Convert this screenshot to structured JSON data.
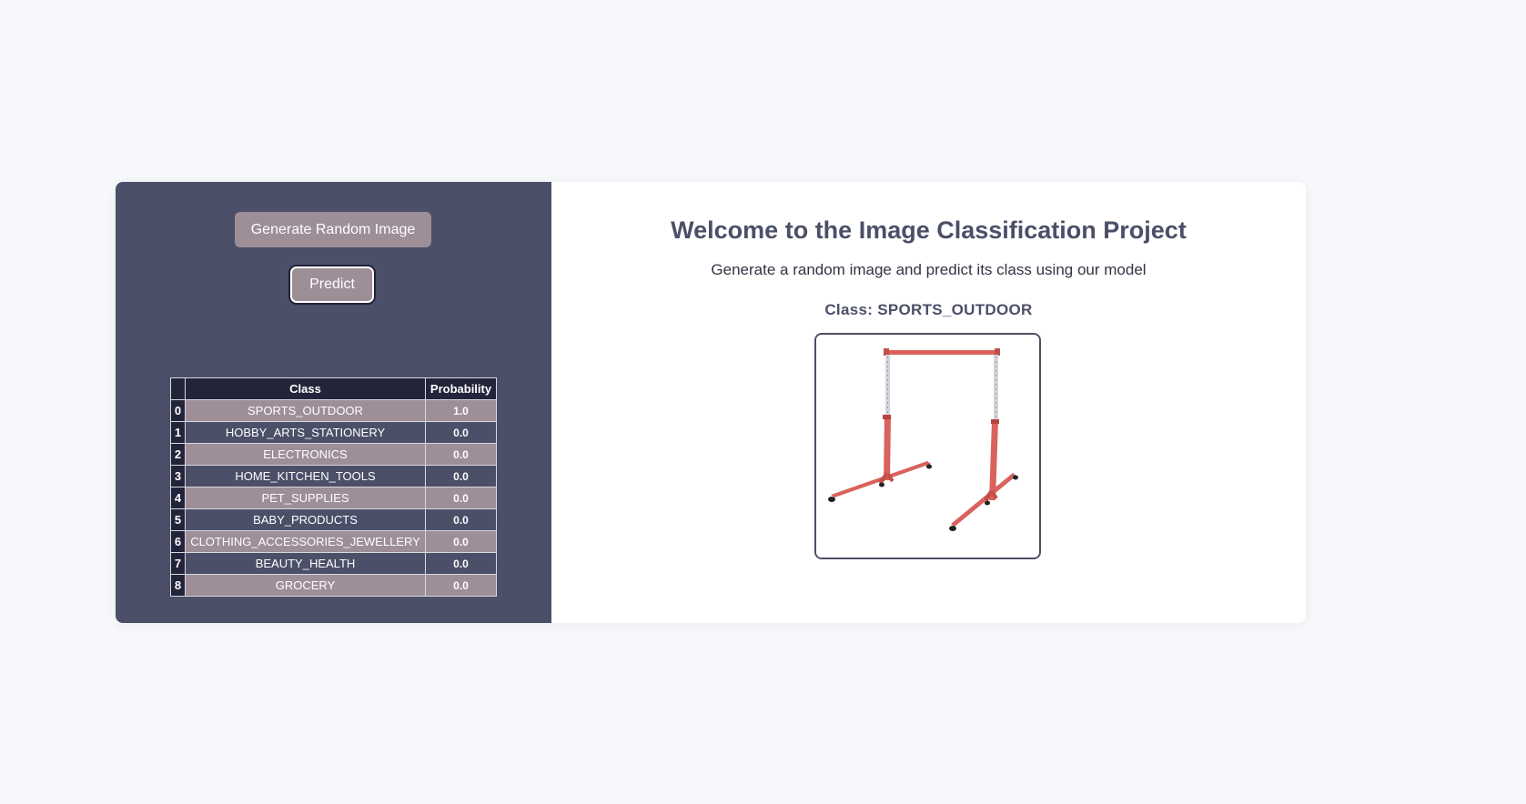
{
  "sidebar": {
    "generate_label": "Generate Random Image",
    "predict_label": "Predict"
  },
  "table": {
    "headers": [
      "",
      "Class",
      "Probability"
    ],
    "rows": [
      {
        "index": "0",
        "class": "SPORTS_OUTDOOR",
        "probability": "1.0"
      },
      {
        "index": "1",
        "class": "HOBBY_ARTS_STATIONERY",
        "probability": "0.0"
      },
      {
        "index": "2",
        "class": "ELECTRONICS",
        "probability": "0.0"
      },
      {
        "index": "3",
        "class": "HOME_KITCHEN_TOOLS",
        "probability": "0.0"
      },
      {
        "index": "4",
        "class": "PET_SUPPLIES",
        "probability": "0.0"
      },
      {
        "index": "5",
        "class": "BABY_PRODUCTS",
        "probability": "0.0"
      },
      {
        "index": "6",
        "class": "CLOTHING_ACCESSORIES_JEWELLERY",
        "probability": "0.0"
      },
      {
        "index": "7",
        "class": "BEAUTY_HEALTH",
        "probability": "0.0"
      },
      {
        "index": "8",
        "class": "GROCERY",
        "probability": "0.0"
      }
    ]
  },
  "main": {
    "title": "Welcome to the Image Classification Project",
    "subtitle": "Generate a random image and predict its class using our model",
    "class_label": "Class: SPORTS_OUTDOOR"
  },
  "colors": {
    "sidebar_bg": "#4b4f68",
    "button_bg": "#9d8e98",
    "header_bg": "#23233a",
    "page_bg": "#f7f8fb"
  }
}
